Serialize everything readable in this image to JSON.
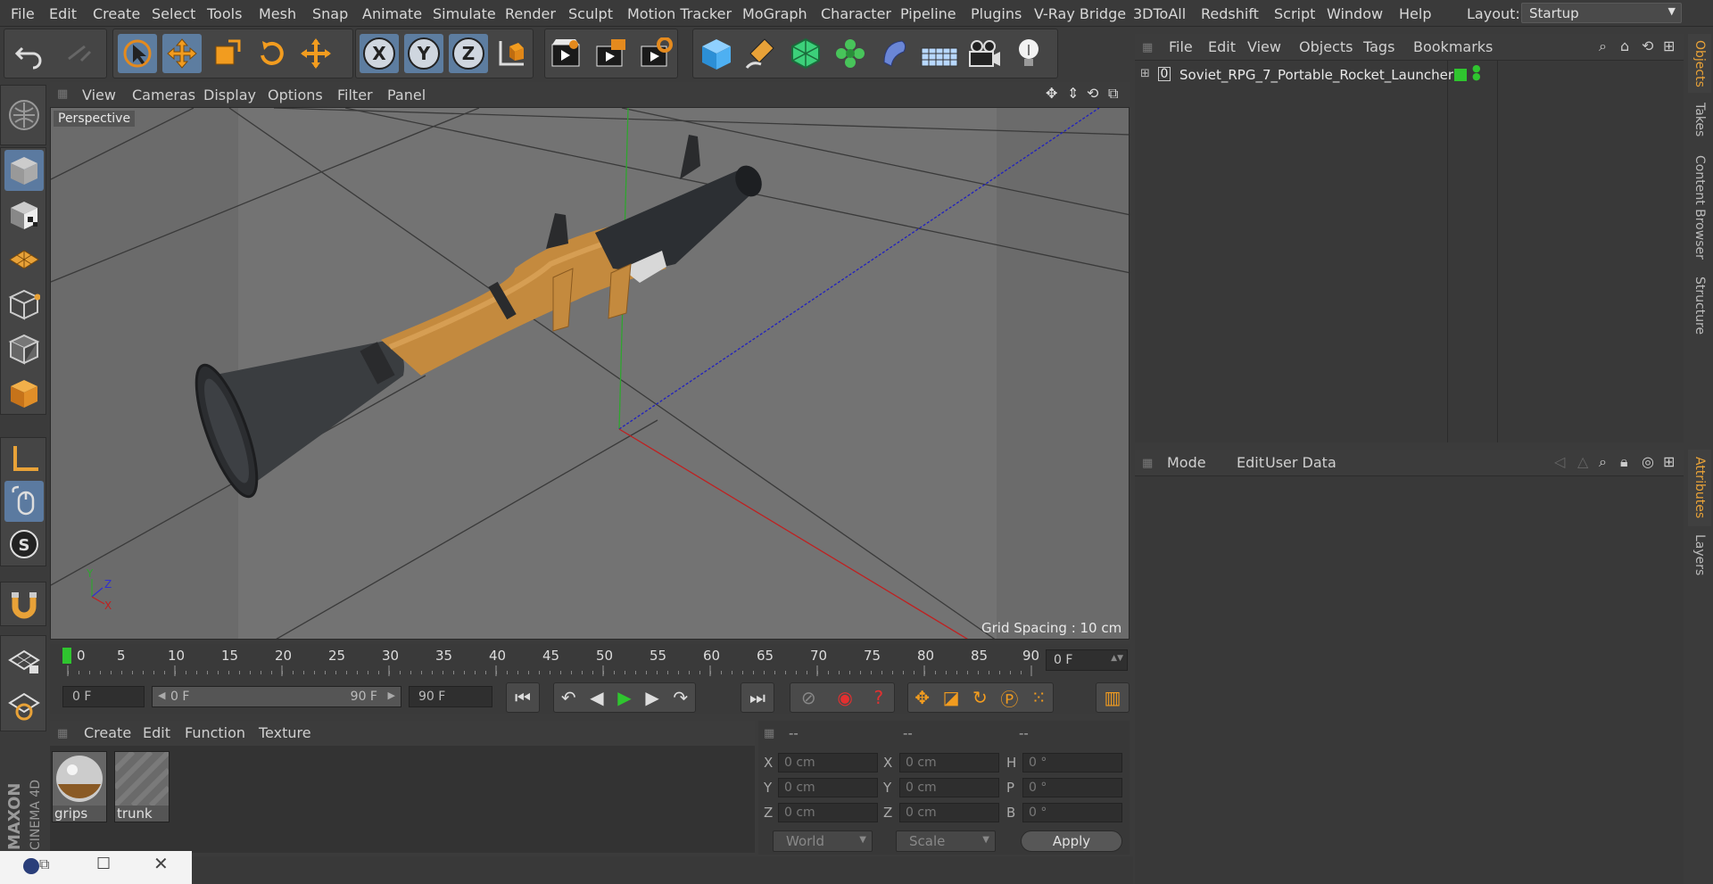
{
  "menubar": {
    "items": [
      "File",
      "Edit",
      "Create",
      "Select",
      "Tools",
      "Mesh",
      "Snap",
      "Animate",
      "Simulate",
      "Render",
      "Sculpt",
      "Motion Tracker",
      "MoGraph",
      "Character",
      "Pipeline",
      "Plugins",
      "V-Ray Bridge",
      "3DToAll",
      "Redshift",
      "Script",
      "Window",
      "Help"
    ],
    "layout_label": "Layout:",
    "layout_value": "Startup"
  },
  "toolbar": {
    "icons": [
      "undo-icon",
      "redo-icon",
      "live-selection-icon",
      "move-icon",
      "scale-icon",
      "rotate-icon",
      "multi-tool-icon",
      "x-axis-icon",
      "y-axis-icon",
      "z-axis-icon",
      "coordinate-system-icon",
      "render-view-icon",
      "render-picture-viewer-icon",
      "edit-render-settings-icon",
      "cube-icon",
      "pen-icon",
      "subdivision-icon",
      "cloner-icon",
      "deformer-icon",
      "floor-icon",
      "camera-icon",
      "light-icon"
    ],
    "axis_x": "X",
    "axis_y": "Y",
    "axis_z": "Z"
  },
  "viewport": {
    "menu": [
      "View",
      "Cameras",
      "Display",
      "Options",
      "Filter",
      "Panel"
    ],
    "name": "Perspective",
    "grid_spacing": "Grid Spacing : 10 cm",
    "axis_y": "Y",
    "axis_z": "Z",
    "axis_x": "X"
  },
  "timeline": {
    "ticks": [
      "0",
      "5",
      "10",
      "15",
      "20",
      "25",
      "30",
      "35",
      "40",
      "45",
      "50",
      "55",
      "60",
      "65",
      "70",
      "75",
      "80",
      "85",
      "90"
    ],
    "current_frame": "0 F",
    "start_field": "0 F",
    "range_start": "0 F",
    "range_end": "90 F",
    "end_field": "90 F"
  },
  "materials": {
    "menu": [
      "Create",
      "Edit",
      "Function",
      "Texture"
    ],
    "items": [
      {
        "label": "grips"
      },
      {
        "label": "trunk"
      }
    ]
  },
  "coordinates": {
    "headers": [
      "--",
      "--",
      "--"
    ],
    "rows": [
      {
        "l1": "X",
        "v1": "0 cm",
        "l2": "X",
        "v2": "0 cm",
        "l3": "H",
        "v3": "0 °"
      },
      {
        "l1": "Y",
        "v1": "0 cm",
        "l2": "Y",
        "v2": "0 cm",
        "l3": "P",
        "v3": "0 °"
      },
      {
        "l1": "Z",
        "v1": "0 cm",
        "l2": "Z",
        "v2": "0 cm",
        "l3": "B",
        "v3": "0 °"
      }
    ],
    "mode_world": "World",
    "mode_scale": "Scale",
    "apply": "Apply"
  },
  "object_manager": {
    "menu": [
      "File",
      "Edit",
      "View",
      "Objects",
      "Tags",
      "Bookmarks"
    ],
    "object_name": "Soviet_RPG_7_Portable_Rocket_Launcher"
  },
  "attributes": {
    "menu": [
      "Mode",
      "Edit",
      "User Data"
    ]
  },
  "right_tabs": [
    "Objects",
    "Takes",
    "Content Browser",
    "Structure",
    "Attributes",
    "Layers"
  ],
  "brand": {
    "line1": "MAXON",
    "line2": "CINEMA 4D"
  },
  "colors": {
    "accent": "#5d7da0",
    "orange": "#e8a238",
    "selection_green": "#2fc52f"
  }
}
